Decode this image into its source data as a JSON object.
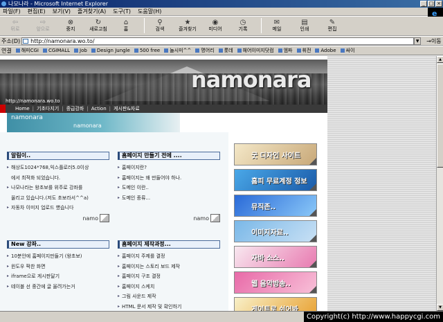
{
  "window": {
    "title": "나모나라 - Microsoft Internet Explorer"
  },
  "menu": [
    "파일(F)",
    "편집(E)",
    "보기(V)",
    "즐겨찾기(A)",
    "도구(T)",
    "도움말(H)"
  ],
  "toolbar": [
    {
      "label": "뒤로",
      "icon": "back-arrow-icon",
      "glyph": "⇦",
      "enabled": false
    },
    {
      "label": "앞으로",
      "icon": "forward-arrow-icon",
      "glyph": "⇨",
      "enabled": false
    },
    {
      "label": "중지",
      "icon": "stop-icon",
      "glyph": "⊗",
      "enabled": true
    },
    {
      "label": "새로고침",
      "icon": "refresh-icon",
      "glyph": "↻",
      "enabled": true
    },
    {
      "label": "홈",
      "icon": "home-icon",
      "glyph": "⌂",
      "enabled": true
    },
    {
      "label": "검색",
      "icon": "search-icon",
      "glyph": "⚲",
      "enabled": true
    },
    {
      "label": "즐겨찾기",
      "icon": "favorites-icon",
      "glyph": "★",
      "enabled": true
    },
    {
      "label": "미디어",
      "icon": "media-icon",
      "glyph": "◉",
      "enabled": true
    },
    {
      "label": "기록",
      "icon": "history-icon",
      "glyph": "◷",
      "enabled": true
    },
    {
      "label": "메일",
      "icon": "mail-icon",
      "glyph": "✉",
      "enabled": true
    },
    {
      "label": "인쇄",
      "icon": "print-icon",
      "glyph": "▤",
      "enabled": true
    },
    {
      "label": "편집",
      "icon": "edit-icon",
      "glyph": "✎",
      "enabled": true
    }
  ],
  "address": {
    "label": "주소(D)",
    "url": "http://namonara.wo.to/",
    "go": "이동"
  },
  "links": {
    "label": "연결",
    "items": [
      "해피CGI",
      "CGIMALL",
      "Job",
      "Design Jungle",
      "500 free",
      "놀시미^^",
      "명어리",
      "롯데",
      "헤어이미지닷컴",
      "엠파",
      "휘전",
      "Adobe",
      "싸이"
    ]
  },
  "banner": {
    "logo": "namonara",
    "url": "http://namonara.wo.to"
  },
  "nav": [
    "Home",
    "기초다지기",
    "중급강좌",
    "Action",
    "게시판&자료"
  ],
  "subbanner": {
    "title": "namonara",
    "subtitle": "namonara"
  },
  "notice": {
    "title": "알림이..",
    "items": [
      {
        "text": "해상도1024*768,익스플로러5.0이상",
        "bullet": true
      },
      {
        "text": "에서 최적화 되었습니다.",
        "bullet": false
      },
      {
        "text": "나모나라는 왕초보를 위주로 강좌를",
        "bullet": true
      },
      {
        "text": "올리고 있습니다.(저도 초보라서^^a)",
        "bullet": false
      },
      {
        "text": "자동차 이미지 업로드 헀습니다",
        "bullet": true
      }
    ],
    "more": "namo"
  },
  "before": {
    "title": "홈페이지 만들기 전에 ....",
    "items": [
      "홈페이지란?",
      "홈페이지는 왜 만들어야 하나.",
      "도메인 이란..",
      "도메인 종류..."
    ],
    "more": "namo"
  },
  "newcourse": {
    "title": "New 강좌..",
    "items": [
      "10분안에 홈페이지만들기 (왕초보)",
      "윈도우 팍찬 화면",
      "iframe으로 게시판달기",
      "테이블 선 중간에 글 올려가는거"
    ]
  },
  "process": {
    "title": "홈페이지 제작과정...",
    "items": [
      "홈페이지 주제를 결정",
      "홈페이지는 스토리 보드 제작",
      "홈페이지 구조 결정",
      "홈페이지 스케치",
      "그림 사운드 제작",
      "HTML 문서 제작 및 확인하기"
    ]
  },
  "sidebuttons": [
    {
      "label": "굿 디자인 사이트",
      "bg1": "#f4e8c8",
      "bg2": "#c8a878"
    },
    {
      "label": "홈피 무료계정 정보",
      "bg1": "#4aa8e8",
      "bg2": "#1a5aa8"
    },
    {
      "label": "뮤직존..",
      "bg1": "#2a6ad8",
      "bg2": "#8ac8f8"
    },
    {
      "label": "이미지자료..",
      "bg1": "#7ab8e8",
      "bg2": "#c8e0f4"
    },
    {
      "label": "자바 소스..",
      "bg1": "#f8e8f0",
      "bg2": "#e87ab0"
    },
    {
      "label": "웹 음악방송..",
      "bg1": "#e86aa8",
      "bg2": "#f8c0d8"
    },
    {
      "label": "게이트로 쉬어봐",
      "bg1": "#f8f0c8",
      "bg2": "#e8a030"
    }
  ],
  "status": {
    "copyright": "Copyright(c) http://www.happycgi.com"
  }
}
